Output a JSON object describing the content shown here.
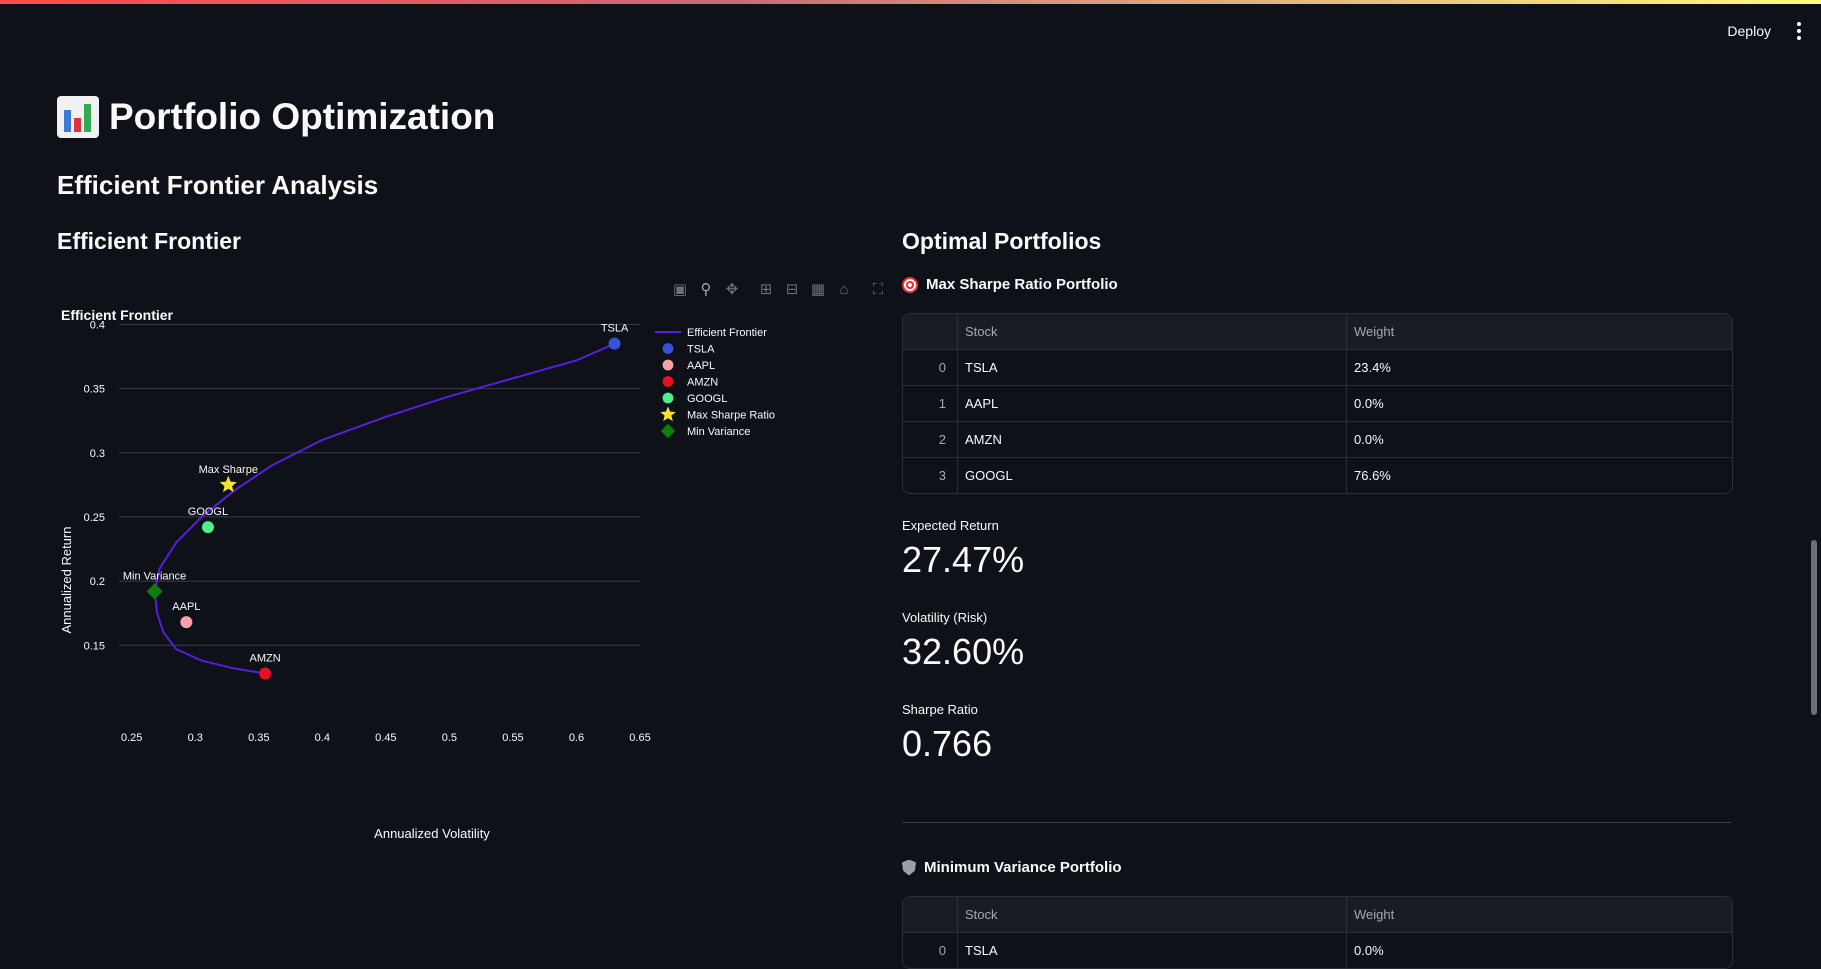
{
  "header": {
    "deploy_label": "Deploy"
  },
  "title": "Portfolio Optimization",
  "section_title": "Efficient Frontier Analysis",
  "left_col": {
    "heading": "Efficient Frontier"
  },
  "right_col": {
    "heading": "Optimal Portfolios"
  },
  "modebar": [
    "camera-icon",
    "zoom-icon",
    "pan-icon",
    "zoom-in-icon",
    "zoom-out-icon",
    "autoscale-icon",
    "reset-axes-icon",
    "fullscreen-icon"
  ],
  "chart_data": {
    "type": "scatter",
    "title": "Efficient Frontier",
    "xlabel": "Annualized Volatility",
    "ylabel": "Annualized Return",
    "xlim": [
      0.24,
      0.65
    ],
    "ylim": [
      0.105,
      0.405
    ],
    "xticks": [
      "0.25",
      "0.3",
      "0.35",
      "0.4",
      "0.45",
      "0.5",
      "0.55",
      "0.6",
      "0.65"
    ],
    "xtick_values": [
      0.25,
      0.3,
      0.35,
      0.4,
      0.45,
      0.5,
      0.55,
      0.6,
      0.65
    ],
    "yticks": [
      "0.15",
      "0.2",
      "0.25",
      "0.3",
      "0.35",
      "0.4"
    ],
    "ytick_values": [
      0.15,
      0.2,
      0.25,
      0.3,
      0.35,
      0.4
    ],
    "grid": true,
    "legend_position": "top-right",
    "frontier": {
      "name": "Efficient Frontier",
      "color": "#5a1de0",
      "x": [
        0.355,
        0.33,
        0.305,
        0.285,
        0.275,
        0.27,
        0.268,
        0.272,
        0.285,
        0.305,
        0.33,
        0.36,
        0.4,
        0.45,
        0.5,
        0.55,
        0.6,
        0.63
      ],
      "y": [
        0.128,
        0.132,
        0.138,
        0.147,
        0.16,
        0.175,
        0.192,
        0.21,
        0.23,
        0.25,
        0.27,
        0.29,
        0.31,
        0.328,
        0.344,
        0.358,
        0.372,
        0.385
      ]
    },
    "points": [
      {
        "name": "TSLA",
        "label": "TSLA",
        "x": 0.63,
        "y": 0.385,
        "color": "#3b4fd8",
        "marker": "circle"
      },
      {
        "name": "AAPL",
        "label": "AAPL",
        "x": 0.293,
        "y": 0.168,
        "color": "#f5a3a8",
        "marker": "circle"
      },
      {
        "name": "AMZN",
        "label": "AMZN",
        "x": 0.355,
        "y": 0.128,
        "color": "#e8101e",
        "marker": "circle"
      },
      {
        "name": "GOOGL",
        "label": "GOOGL",
        "x": 0.31,
        "y": 0.242,
        "color": "#4ef08c",
        "marker": "circle"
      },
      {
        "name": "Max Sharpe Ratio",
        "label": "Max Sharpe",
        "x": 0.326,
        "y": 0.275,
        "color": "#f4e52a",
        "marker": "star"
      },
      {
        "name": "Min Variance",
        "label": "Min Variance",
        "x": 0.268,
        "y": 0.192,
        "color": "#0d7d0d",
        "marker": "diamond"
      }
    ]
  },
  "max_sharpe": {
    "title": "Max Sharpe Ratio Portfolio",
    "table": {
      "headers": [
        "",
        "Stock",
        "Weight"
      ],
      "rows": [
        [
          "0",
          "TSLA",
          "23.4%"
        ],
        [
          "1",
          "AAPL",
          "0.0%"
        ],
        [
          "2",
          "AMZN",
          "0.0%"
        ],
        [
          "3",
          "GOOGL",
          "76.6%"
        ]
      ]
    },
    "metrics": [
      {
        "label": "Expected Return",
        "value": "27.47%"
      },
      {
        "label": "Volatility (Risk)",
        "value": "32.60%"
      },
      {
        "label": "Sharpe Ratio",
        "value": "0.766"
      }
    ]
  },
  "min_variance": {
    "title": "Minimum Variance Portfolio",
    "table": {
      "headers": [
        "",
        "Stock",
        "Weight"
      ],
      "rows": [
        [
          "0",
          "TSLA",
          "0.0%"
        ]
      ]
    }
  }
}
